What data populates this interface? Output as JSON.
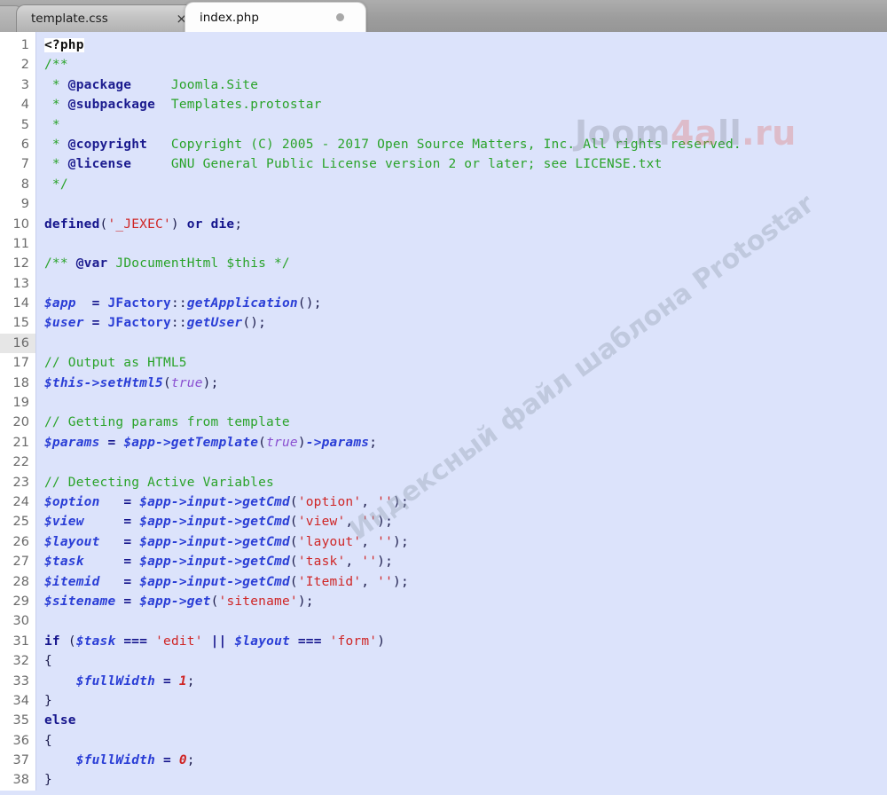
{
  "window": {
    "title": "index.php"
  },
  "tabs": [
    {
      "label": "template.css",
      "active": false,
      "close_icon": "×",
      "dirty": false
    },
    {
      "label": "index.php",
      "active": true,
      "close_icon": "",
      "dirty": true
    }
  ],
  "editor": {
    "current_line": 16,
    "first_line": 1,
    "last_line": 38,
    "background_color": "#dce3fb",
    "gutter_color": "#ffffff",
    "current_line_gutter_color": "#e6e6e6",
    "line_numbers": [
      1,
      2,
      3,
      4,
      5,
      6,
      7,
      8,
      9,
      10,
      11,
      12,
      13,
      14,
      15,
      16,
      17,
      18,
      19,
      20,
      21,
      22,
      23,
      24,
      25,
      26,
      27,
      28,
      29,
      30,
      31,
      32,
      33,
      34,
      35,
      36,
      37,
      38
    ],
    "lines": [
      "<?php",
      "/**",
      " * @package     Joomla.Site",
      " * @subpackage  Templates.protostar",
      " *",
      " * @copyright   Copyright (C) 2005 - 2017 Open Source Matters, Inc. All rights reserved.",
      " * @license     GNU General Public License version 2 or later; see LICENSE.txt",
      " */",
      "",
      "defined('_JEXEC') or die;",
      "",
      "/** @var JDocumentHtml $this */",
      "",
      "$app  = JFactory::getApplication();",
      "$user = JFactory::getUser();",
      "",
      "// Output as HTML5",
      "$this->setHtml5(true);",
      "",
      "// Getting params from template",
      "$params = $app->getTemplate(true)->params;",
      "",
      "// Detecting Active Variables",
      "$option   = $app->input->getCmd('option', '');",
      "$view     = $app->input->getCmd('view', '');",
      "$layout   = $app->input->getCmd('layout', '');",
      "$task     = $app->input->getCmd('task', '');",
      "$itemid   = $app->input->getCmd('Itemid', '');",
      "$sitename = $app->get('sitename');",
      "",
      "if ($task === 'edit' || $layout === 'form')",
      "{",
      "    $fullWidth = 1;",
      "}",
      "else",
      "{",
      "    $fullWidth = 0;",
      "}"
    ]
  },
  "watermarks": {
    "logo": {
      "part1": "Joom",
      "part2": "4a",
      "part3": "ll",
      "part4": ".ru",
      "color_grey": "#7a7f8c",
      "color_red": "#e2645c"
    },
    "diagonal": {
      "text": "Индексный файл шаблона Protostar",
      "color": "#9aa6b8",
      "rotation_deg": -36
    }
  }
}
